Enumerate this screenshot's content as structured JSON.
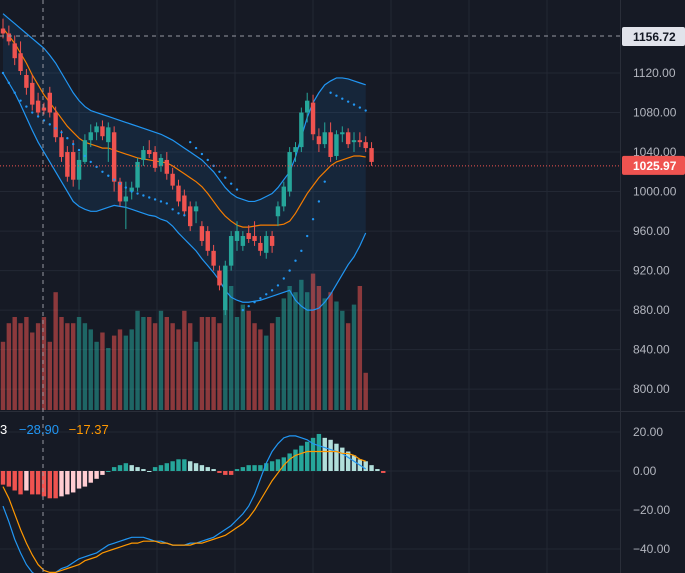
{
  "colors": {
    "background": "#161a25",
    "grid": "#232834",
    "up": "#26a69a",
    "down": "#ef5350",
    "up_light": "#b2dfdb",
    "down_light": "#ffcdd2",
    "bollinger": "#2196f3",
    "ma": "#f57c00",
    "macd_line": "#2196f3",
    "signal_line": "#ff9800",
    "axis_text": "#b2b5be"
  },
  "main_axis": {
    "ticks": [
      "1120.00",
      "1080.00",
      "1040.00",
      "1000.00",
      "960.00",
      "920.00",
      "880.00",
      "840.00",
      "800.00"
    ],
    "crosshair_label": "1156.72",
    "last_price_label": "1025.97"
  },
  "macd_axis": {
    "ticks": [
      "20.00",
      "0.00",
      "−20.00",
      "−40.00"
    ]
  },
  "macd_legend": {
    "first": "3",
    "macd": "−28.90",
    "signal": "−17.37"
  },
  "chart_data": {
    "type": "candlestick",
    "ylim": [
      780,
      1170
    ],
    "candles": [
      {
        "o": 1165,
        "h": 1175,
        "l": 1155,
        "c": 1160
      },
      {
        "o": 1160,
        "h": 1168,
        "l": 1148,
        "c": 1152
      },
      {
        "o": 1150,
        "h": 1158,
        "l": 1128,
        "c": 1135
      },
      {
        "o": 1140,
        "h": 1152,
        "l": 1118,
        "c": 1122
      },
      {
        "o": 1118,
        "h": 1124,
        "l": 1098,
        "c": 1105
      },
      {
        "o": 1110,
        "h": 1118,
        "l": 1082,
        "c": 1088
      },
      {
        "o": 1092,
        "h": 1100,
        "l": 1075,
        "c": 1080
      },
      {
        "o": 1085,
        "h": 1090,
        "l": 1078,
        "c": 1082
      },
      {
        "o": 1100,
        "h": 1106,
        "l": 1075,
        "c": 1080
      },
      {
        "o": 1080,
        "h": 1086,
        "l": 1050,
        "c": 1055
      },
      {
        "o": 1055,
        "h": 1062,
        "l": 1030,
        "c": 1035
      },
      {
        "o": 1040,
        "h": 1046,
        "l": 1010,
        "c": 1015
      },
      {
        "o": 1040,
        "h": 1052,
        "l": 1005,
        "c": 1012
      },
      {
        "o": 1012,
        "h": 1040,
        "l": 1002,
        "c": 1032
      },
      {
        "o": 1030,
        "h": 1058,
        "l": 1028,
        "c": 1052
      },
      {
        "o": 1052,
        "h": 1068,
        "l": 1045,
        "c": 1060
      },
      {
        "o": 1060,
        "h": 1070,
        "l": 1052,
        "c": 1066
      },
      {
        "o": 1066,
        "h": 1072,
        "l": 1052,
        "c": 1056
      },
      {
        "o": 1050,
        "h": 1070,
        "l": 1030,
        "c": 1065
      },
      {
        "o": 1060,
        "h": 1066,
        "l": 1000,
        "c": 1010
      },
      {
        "o": 1010,
        "h": 1014,
        "l": 985,
        "c": 990
      },
      {
        "o": 990,
        "h": 1010,
        "l": 962,
        "c": 995
      },
      {
        "o": 1000,
        "h": 1010,
        "l": 992,
        "c": 1004
      },
      {
        "o": 1004,
        "h": 1034,
        "l": 1000,
        "c": 1030
      },
      {
        "o": 1032,
        "h": 1046,
        "l": 1026,
        "c": 1042
      },
      {
        "o": 1042,
        "h": 1052,
        "l": 1034,
        "c": 1038
      },
      {
        "o": 1040,
        "h": 1046,
        "l": 1020,
        "c": 1024
      },
      {
        "o": 1026,
        "h": 1038,
        "l": 1020,
        "c": 1034
      },
      {
        "o": 1032,
        "h": 1040,
        "l": 1012,
        "c": 1018
      },
      {
        "o": 1018,
        "h": 1024,
        "l": 1002,
        "c": 1006
      },
      {
        "o": 1006,
        "h": 1012,
        "l": 985,
        "c": 990
      },
      {
        "o": 996,
        "h": 1002,
        "l": 975,
        "c": 980
      },
      {
        "o": 985,
        "h": 990,
        "l": 960,
        "c": 965
      },
      {
        "o": 980,
        "h": 990,
        "l": 968,
        "c": 985
      },
      {
        "o": 965,
        "h": 970,
        "l": 945,
        "c": 950
      },
      {
        "o": 960,
        "h": 965,
        "l": 935,
        "c": 940
      },
      {
        "o": 940,
        "h": 946,
        "l": 920,
        "c": 925
      },
      {
        "o": 920,
        "h": 925,
        "l": 900,
        "c": 905
      },
      {
        "o": 880,
        "h": 930,
        "l": 875,
        "c": 925
      },
      {
        "o": 925,
        "h": 960,
        "l": 920,
        "c": 955
      },
      {
        "o": 950,
        "h": 970,
        "l": 940,
        "c": 960
      },
      {
        "o": 945,
        "h": 960,
        "l": 940,
        "c": 955
      },
      {
        "o": 958,
        "h": 966,
        "l": 948,
        "c": 952
      },
      {
        "o": 955,
        "h": 970,
        "l": 945,
        "c": 950
      },
      {
        "o": 948,
        "h": 955,
        "l": 935,
        "c": 940
      },
      {
        "o": 938,
        "h": 960,
        "l": 932,
        "c": 955
      },
      {
        "o": 955,
        "h": 960,
        "l": 938,
        "c": 945
      },
      {
        "o": 975,
        "h": 990,
        "l": 965,
        "c": 985
      },
      {
        "o": 985,
        "h": 1010,
        "l": 980,
        "c": 1005
      },
      {
        "o": 1000,
        "h": 1045,
        "l": 995,
        "c": 1040
      },
      {
        "o": 1040,
        "h": 1050,
        "l": 1030,
        "c": 1045
      },
      {
        "o": 1045,
        "h": 1085,
        "l": 1040,
        "c": 1080
      },
      {
        "o": 1080,
        "h": 1100,
        "l": 1070,
        "c": 1092
      },
      {
        "o": 1090,
        "h": 1098,
        "l": 1052,
        "c": 1058
      },
      {
        "o": 1056,
        "h": 1064,
        "l": 1040,
        "c": 1048
      },
      {
        "o": 1048,
        "h": 1070,
        "l": 1044,
        "c": 1060
      },
      {
        "o": 1060,
        "h": 1070,
        "l": 1030,
        "c": 1035
      },
      {
        "o": 1036,
        "h": 1062,
        "l": 1032,
        "c": 1058
      },
      {
        "o": 1058,
        "h": 1066,
        "l": 1050,
        "c": 1060
      },
      {
        "o": 1060,
        "h": 1064,
        "l": 1044,
        "c": 1048
      },
      {
        "o": 1050,
        "h": 1060,
        "l": 1040,
        "c": 1052
      },
      {
        "o": 1052,
        "h": 1060,
        "l": 1045,
        "c": 1050
      },
      {
        "o": 1050,
        "h": 1056,
        "l": 1040,
        "c": 1044
      },
      {
        "o": 1044,
        "h": 1050,
        "l": 1026,
        "c": 1030
      }
    ],
    "volume": [
      22,
      28,
      30,
      28,
      30,
      25,
      28,
      30,
      22,
      38,
      30,
      28,
      28,
      30,
      28,
      26,
      22,
      25,
      20,
      24,
      26,
      24,
      26,
      32,
      30,
      30,
      28,
      32,
      30,
      28,
      26,
      32,
      28,
      22,
      30,
      30,
      30,
      28,
      42,
      40,
      30,
      34,
      32,
      28,
      26,
      24,
      28,
      30,
      36,
      40,
      38,
      42,
      38,
      44,
      40,
      36,
      38,
      35,
      32,
      28,
      34,
      40,
      12
    ],
    "bb_upper": [
      1180,
      1175,
      1170,
      1165,
      1160,
      1155,
      1150,
      1145,
      1138,
      1130,
      1120,
      1110,
      1100,
      1092,
      1086,
      1082,
      1080,
      1078,
      1076,
      1074,
      1072,
      1070,
      1068,
      1066,
      1064,
      1062,
      1060,
      1058,
      1055,
      1052,
      1048,
      1044,
      1040,
      1036,
      1032,
      1026,
      1020,
      1012,
      1004,
      998,
      994,
      992,
      990,
      990,
      992,
      995,
      998,
      1004,
      1012,
      1020,
      1035,
      1055,
      1075,
      1090,
      1100,
      1108,
      1112,
      1115,
      1115,
      1114,
      1112,
      1110,
      1108
    ],
    "bb_lower": [
      1120,
      1110,
      1100,
      1088,
      1075,
      1062,
      1050,
      1040,
      1030,
      1020,
      1010,
      1000,
      990,
      985,
      982,
      980,
      980,
      982,
      984,
      986,
      985,
      984,
      982,
      980,
      978,
      976,
      975,
      972,
      970,
      965,
      958,
      952,
      946,
      940,
      932,
      925,
      918,
      910,
      900,
      893,
      890,
      888,
      888,
      889,
      890,
      892,
      894,
      896,
      898,
      900,
      890,
      884,
      880,
      880,
      882,
      888,
      896,
      906,
      916,
      926,
      934,
      945,
      958
    ],
    "ma": [
      1165,
      1158,
      1150,
      1140,
      1130,
      1118,
      1108,
      1098,
      1090,
      1082,
      1074,
      1066,
      1060,
      1054,
      1050,
      1048,
      1046,
      1044,
      1044,
      1042,
      1040,
      1038,
      1036,
      1034,
      1033,
      1032,
      1031,
      1030,
      1029,
      1026,
      1022,
      1018,
      1014,
      1010,
      1005,
      998,
      990,
      982,
      975,
      970,
      966,
      964,
      964,
      965,
      966,
      966,
      966,
      966,
      967,
      970,
      978,
      988,
      998,
      1006,
      1014,
      1020,
      1026,
      1030,
      1032,
      1034,
      1036,
      1036,
      1035
    ],
    "sar": [
      1120,
      1110,
      1100,
      1092,
      1086,
      1080,
      1076,
      1072,
      1068,
      1064,
      1060,
      1054,
      1048,
      1042,
      1036,
      1030,
      1025,
      1020,
      1016,
      1012,
      1008,
      1004,
      1000,
      998,
      996,
      994,
      992,
      990,
      988,
      982,
      978,
      976,
      1050,
      1044,
      1038,
      1032,
      1026,
      1020,
      1014,
      1008,
      1002,
      880,
      884,
      888,
      892,
      896,
      900,
      905,
      912,
      920,
      930,
      940,
      955,
      972,
      990,
      1010,
      1100,
      1097,
      1094,
      1091,
      1088,
      1085,
      1082
    ],
    "macd_hist": [
      -7,
      -8,
      -10,
      -12,
      -10,
      -12,
      -12,
      -13,
      -14,
      -14,
      -13,
      -12,
      -11,
      -9,
      -8,
      -6,
      -4,
      -2,
      0,
      2,
      3,
      4,
      3,
      2,
      1,
      0,
      2,
      3,
      4,
      5,
      6,
      6,
      5,
      4,
      3,
      2,
      1,
      -1,
      -2,
      -2,
      1,
      2,
      3,
      3,
      3,
      4,
      5,
      6,
      7,
      9,
      11,
      13,
      15,
      17,
      19,
      17,
      16,
      14,
      12,
      10,
      8,
      6,
      5,
      3,
      1,
      -1
    ],
    "macd_line": [
      -18,
      -26,
      -35,
      -42,
      -48,
      -52,
      -54,
      -55,
      -54,
      -52,
      -50,
      -49,
      -47,
      -45,
      -44,
      -43,
      -42,
      -40,
      -38,
      -37,
      -36,
      -35,
      -34,
      -34,
      -34,
      -35,
      -36,
      -36,
      -37,
      -38,
      -38,
      -38,
      -37,
      -37,
      -36,
      -35,
      -34,
      -32,
      -30,
      -28,
      -25,
      -22,
      -18,
      -12,
      -4,
      4,
      10,
      14,
      17,
      18,
      18,
      17,
      16,
      14,
      13,
      12,
      11,
      10,
      9,
      7,
      5,
      3,
      1
    ],
    "signal_line": [
      -8,
      -14,
      -22,
      -30,
      -37,
      -43,
      -48,
      -51,
      -52,
      -52,
      -51,
      -50,
      -49,
      -48,
      -46,
      -45,
      -44,
      -42,
      -41,
      -40,
      -39,
      -38,
      -37,
      -37,
      -36,
      -36,
      -36,
      -37,
      -37,
      -38,
      -38,
      -38,
      -38,
      -37,
      -37,
      -36,
      -35,
      -34,
      -33,
      -31,
      -29,
      -27,
      -24,
      -20,
      -15,
      -10,
      -5,
      -1,
      3,
      6,
      8,
      9,
      10,
      10,
      10,
      10,
      10,
      10,
      9,
      9,
      8,
      6,
      5
    ]
  }
}
